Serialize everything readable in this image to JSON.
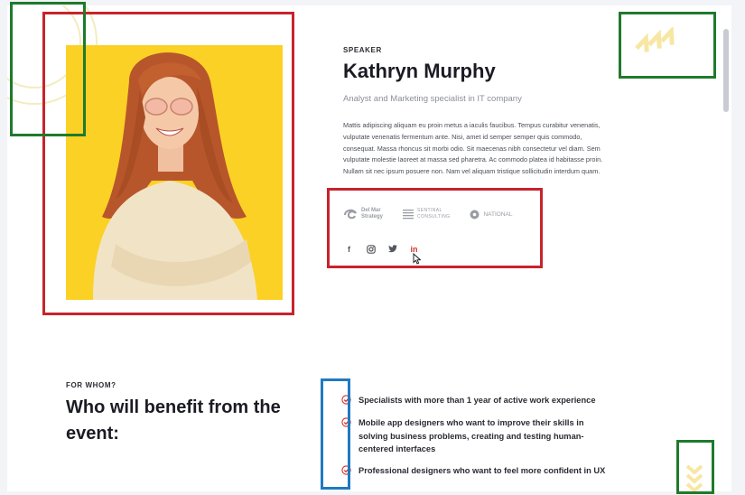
{
  "speaker": {
    "label": "SPEAKER",
    "name": "Kathryn Murphy",
    "title": "Analyst and Marketing specialist in IT company",
    "bio": "Mattis adipiscing aliquam eu proin metus a iaculis faucibus. Tempus curabitur venenatis, vulputate venenatis fermentum ante. Nisi, amet id semper semper quis commodo, consequat. Massa rhoncus sit morbi odio. Sit maecenas nibh consectetur vel diam. Sem vulputate molestie laoreet at massa sed pharetra. Ac commodo platea id habitasse proin. Nullam sit nec ipsum posuere non. Nam vel aliquam tristique sollicitudin interdum quam.",
    "logos": [
      {
        "name": "Del Mar Strategy",
        "line1": "Del Mar",
        "line2": "Strategy",
        "icon": "swirl-logo-icon"
      },
      {
        "name": "Sentinal Consulting",
        "line1": "SENTINAL",
        "line2": "CONSULTING",
        "icon": "lines-logo-icon"
      },
      {
        "name": "National",
        "line1": "NATIONAL",
        "icon": "circle-logo-icon"
      }
    ],
    "socials": [
      {
        "name": "facebook",
        "glyph": "f",
        "icon": "facebook-icon"
      },
      {
        "name": "instagram",
        "icon": "instagram-icon"
      },
      {
        "name": "twitter",
        "icon": "twitter-icon"
      },
      {
        "name": "linkedin",
        "glyph": "in",
        "icon": "linkedin-icon",
        "active": true
      }
    ]
  },
  "for_whom": {
    "label": "FOR WHOM?",
    "heading": "Who will benefit from the event:",
    "items": [
      "Specialists with more than 1 year of active work experience",
      "Mobile app designers who want to improve their skills in solving business problems, creating and testing human-centered interfaces",
      "Professional designers who want to feel more confident in UX"
    ]
  },
  "colors": {
    "photo_background": "#fcd126",
    "accent_red": "#d8322e",
    "annotation_red": "#c8232c",
    "annotation_green": "#1f7a2c",
    "annotation_blue": "#1f7ac0",
    "decor_yellow": "#f7e7a3"
  }
}
